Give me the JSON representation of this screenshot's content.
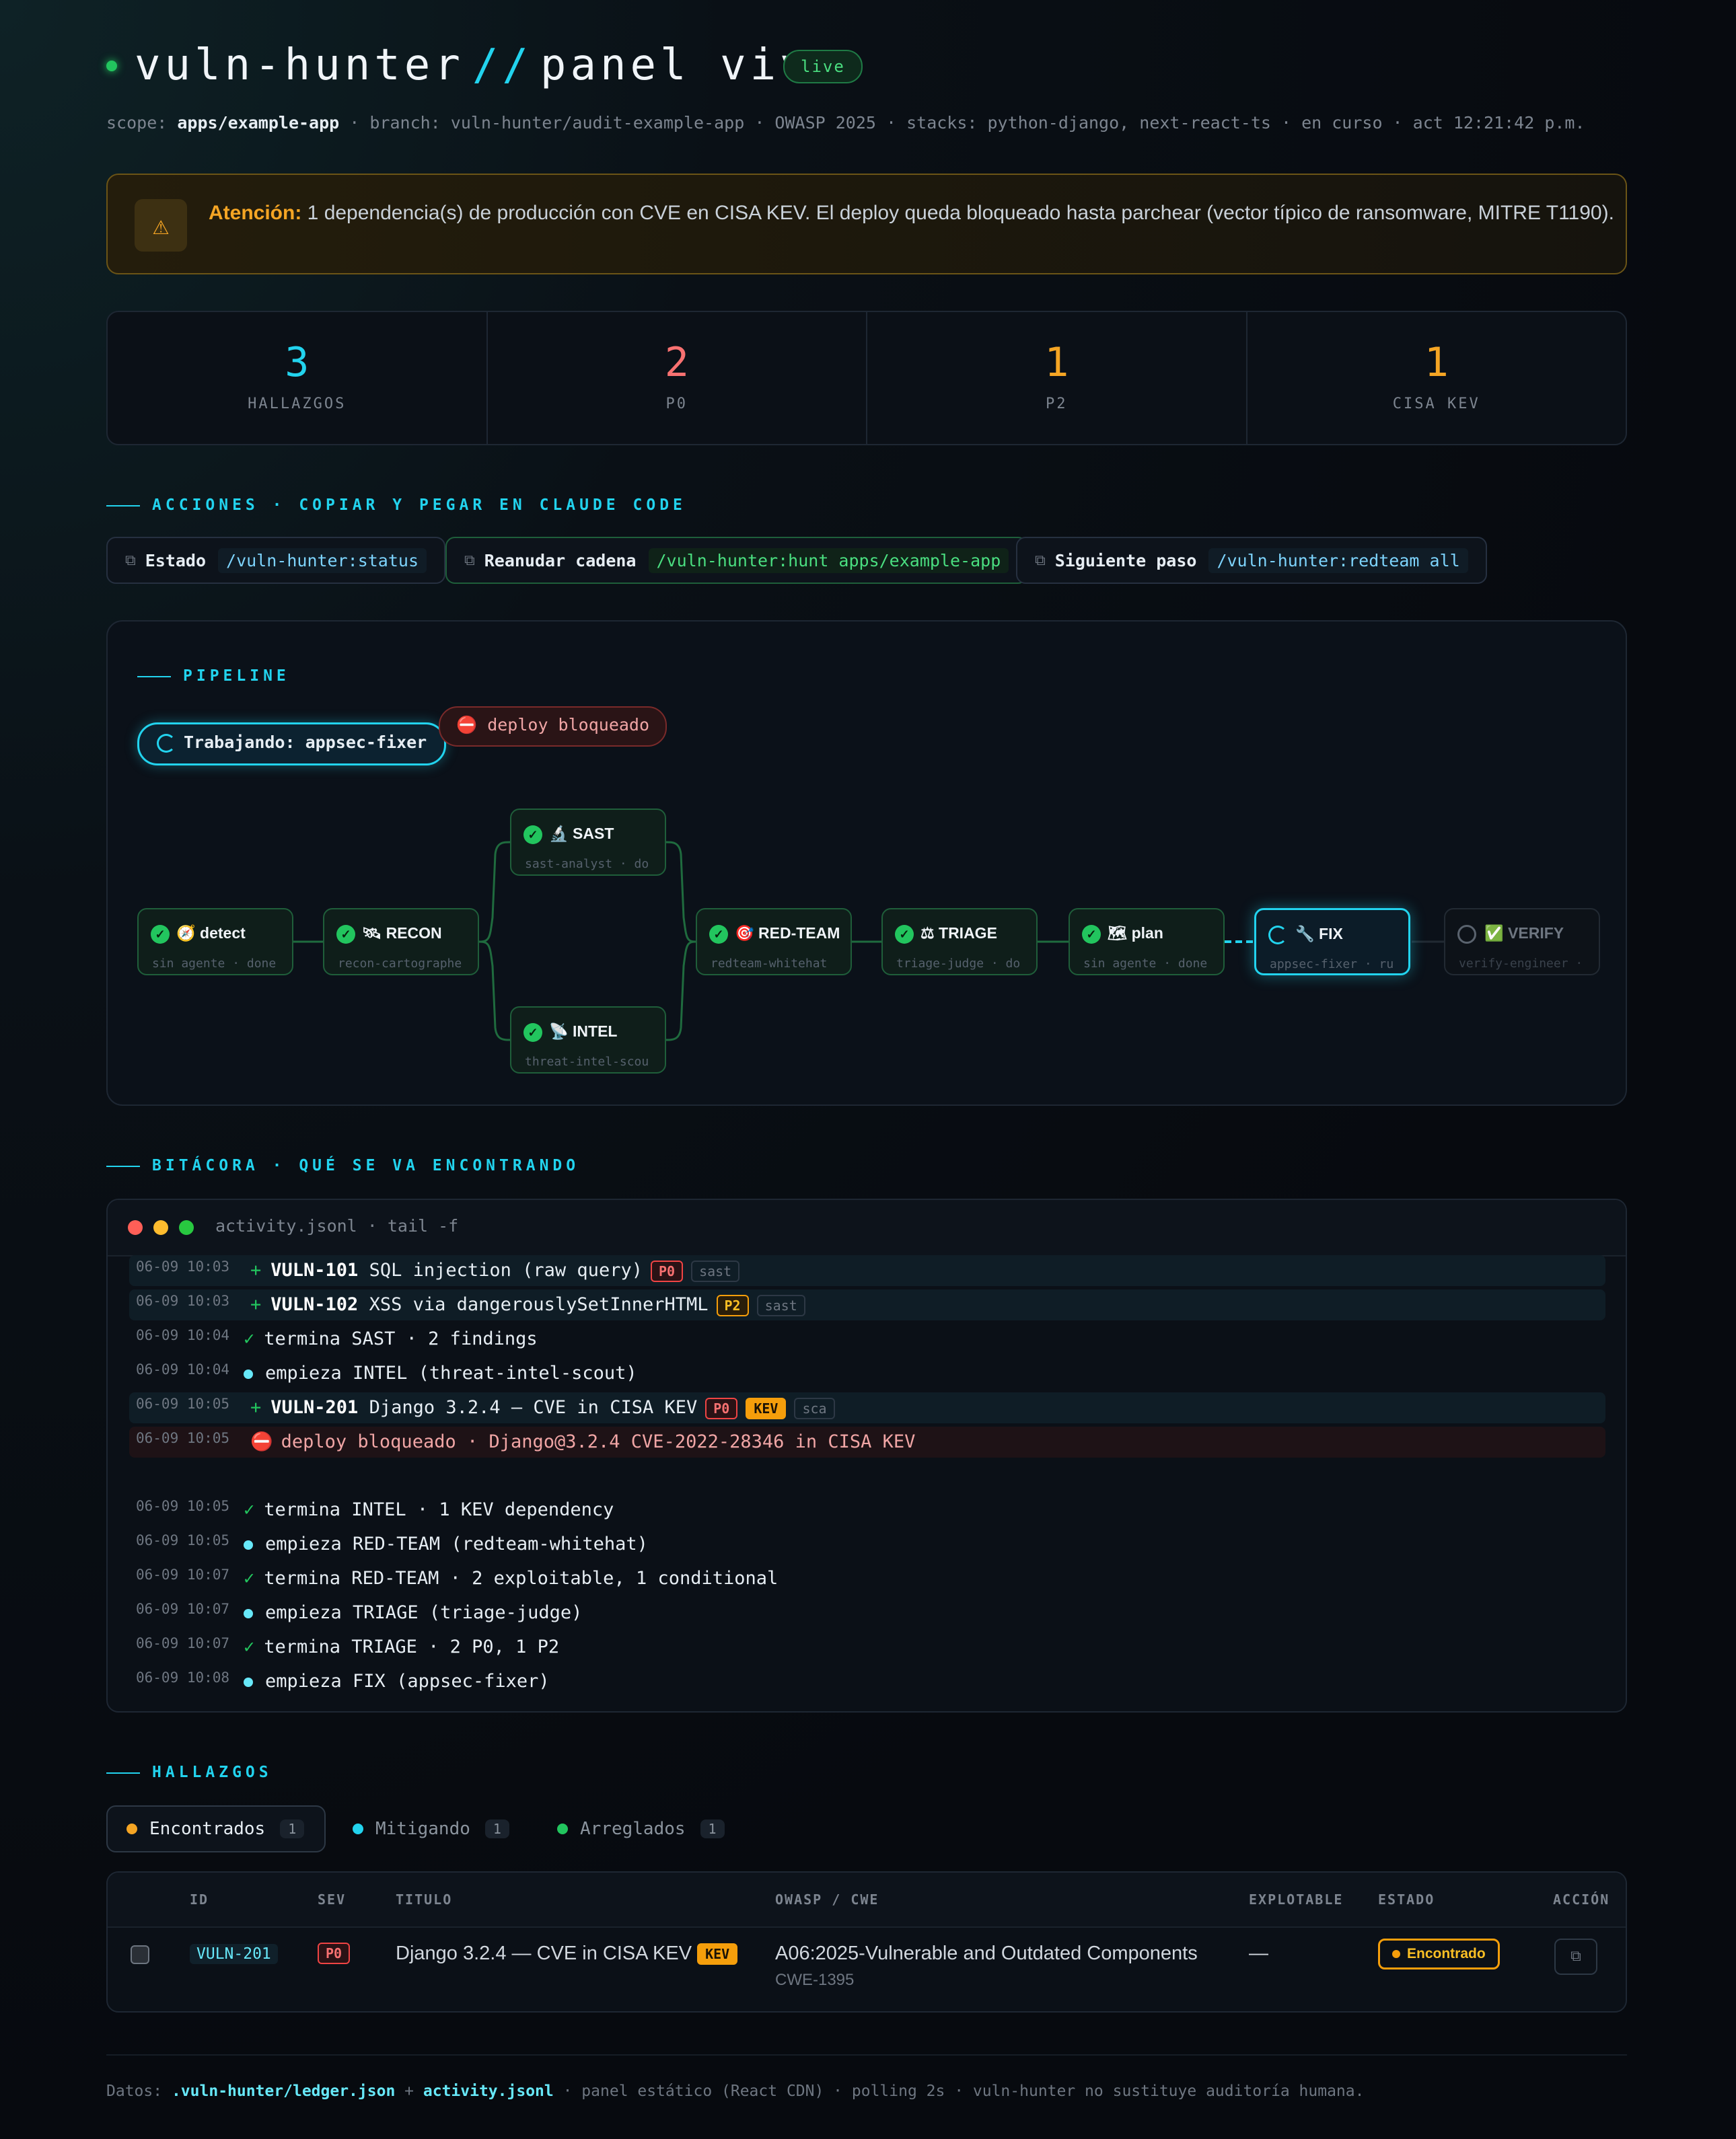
{
  "header": {
    "title_left": "vuln-hunter",
    "title_sep": "//",
    "title_right": "panel vivo",
    "live": "live",
    "scope_label": "scope:",
    "scope_value": "apps/example-app",
    "meta_rest": "· branch: vuln-hunter/audit-example-app · OWASP 2025 · stacks: python-django, next-react-ts · en curso · act 12:21:42 p.m."
  },
  "alert": {
    "icon": "warning-icon",
    "strong": "Atención:",
    "text": "1 dependencia(s) de producción con CVE en CISA KEV. El deploy queda bloqueado hasta parchear (vector típico de ransomware, MITRE T1190)."
  },
  "stats": [
    {
      "value": "3",
      "label": "HALLAZGOS",
      "color": "#22d3ee"
    },
    {
      "value": "2",
      "label": "P0",
      "color": "#f87171"
    },
    {
      "value": "1",
      "label": "P2",
      "color": "#f5a524"
    },
    {
      "value": "1",
      "label": "CISA KEV",
      "color": "#f5a524"
    }
  ],
  "actions": {
    "heading": "ACCIONES · COPIAR Y PEGAR EN CLAUDE CODE",
    "items": [
      {
        "label": "Estado",
        "cmd": "/vuln-hunter:status"
      },
      {
        "label": "Reanudar cadena",
        "cmd": "/vuln-hunter:hunt apps/example-app"
      },
      {
        "label": "Siguiente paso",
        "cmd": "/vuln-hunter:redteam all"
      }
    ]
  },
  "pipeline": {
    "heading": "PIPELINE",
    "working": "Trabajando: appsec-fixer",
    "blocked": "deploy bloqueado",
    "nodes": [
      {
        "title": "detect",
        "emoji": "🧭",
        "sub": "sin agente · done",
        "state": "done"
      },
      {
        "title": "RECON",
        "emoji": "🛰",
        "sub": "recon-cartographe",
        "state": "done"
      },
      {
        "title": "SAST",
        "emoji": "🔬",
        "sub": "sast-analyst · do",
        "state": "done"
      },
      {
        "title": "INTEL",
        "emoji": "📡",
        "sub": "threat-intel-scou",
        "state": "done"
      },
      {
        "title": "RED-TEAM",
        "emoji": "🎯",
        "sub": "redteam-whitehat",
        "state": "done"
      },
      {
        "title": "TRIAGE",
        "emoji": "⚖",
        "sub": "triage-judge · do",
        "state": "done"
      },
      {
        "title": "plan",
        "emoji": "🗺",
        "sub": "sin agente · done",
        "state": "done"
      },
      {
        "title": "FIX",
        "emoji": "🔧",
        "sub": "appsec-fixer · ru",
        "state": "active"
      },
      {
        "title": "VERIFY",
        "emoji": "✅",
        "sub": "verify-engineer ·",
        "state": "pending"
      }
    ]
  },
  "log": {
    "heading": "BITÁCORA · QUÉ SE VA ENCONTRANDO",
    "title": "activity.jsonl · tail -f",
    "rows": [
      {
        "ts": "06-09 10:03",
        "id": "VULN-101",
        "text": "SQL injection (raw query)",
        "sev": "P0",
        "src": "sast"
      },
      {
        "ts": "06-09 10:03",
        "id": "VULN-102",
        "text": "XSS via dangerouslySetInnerHTML",
        "sev": "P2",
        "src": "sast"
      },
      {
        "ts": "06-09 10:04",
        "text": "termina SAST · 2 findings"
      },
      {
        "ts": "06-09 10:04",
        "text": "empieza INTEL (threat-intel-scout)"
      },
      {
        "ts": "06-09 10:05",
        "id": "VULN-201",
        "text": "Django 3.2.4 — CVE in CISA KEV",
        "sev": "P0",
        "kev": "KEV",
        "src": "sca"
      },
      {
        "ts": "06-09 10:05",
        "text": "deploy bloqueado · Django@3.2.4 CVE-2022-28346 in CISA KEV"
      },
      {
        "ts": "06-09 10:05",
        "text": "termina INTEL · 1 KEV dependency"
      },
      {
        "ts": "06-09 10:05",
        "text": "empieza RED-TEAM (redteam-whitehat)"
      },
      {
        "ts": "06-09 10:07",
        "text": "termina RED-TEAM · 2 exploitable, 1 conditional"
      },
      {
        "ts": "06-09 10:07",
        "text": "empieza TRIAGE (triage-judge)"
      },
      {
        "ts": "06-09 10:07",
        "text": "termina TRIAGE · 2 P0, 1 P2"
      },
      {
        "ts": "06-09 10:08",
        "text": "empieza FIX (appsec-fixer)"
      }
    ]
  },
  "findings": {
    "heading": "HALLAZGOS",
    "tabs": [
      {
        "label": "Encontrados",
        "count": "1",
        "color": "#f5a524"
      },
      {
        "label": "Mitigando",
        "count": "1",
        "color": "#22d3ee"
      },
      {
        "label": "Arreglados",
        "count": "1",
        "color": "#22c55e"
      }
    ],
    "columns": [
      "ID",
      "SEV",
      "TITULO",
      "OWASP / CWE",
      "EXPLOTABLE",
      "ESTADO",
      "ACCIÓN"
    ],
    "row": {
      "id": "VULN-201",
      "sev": "P0",
      "title": "Django 3.2.4 — CVE in CISA KEV",
      "kev": "KEV",
      "owasp": "A06:2025-Vulnerable and Outdated Components",
      "cwe": "CWE-1395",
      "exploitable": "—",
      "state": "Encontrado"
    }
  },
  "footer": {
    "prefix": "Datos:",
    "file1": ".vuln-hunter/ledger.json",
    "plus": "+",
    "file2": "activity.jsonl",
    "rest": "· panel estático (React CDN) · polling 2s · vuln-hunter no sustituye auditoría humana."
  }
}
